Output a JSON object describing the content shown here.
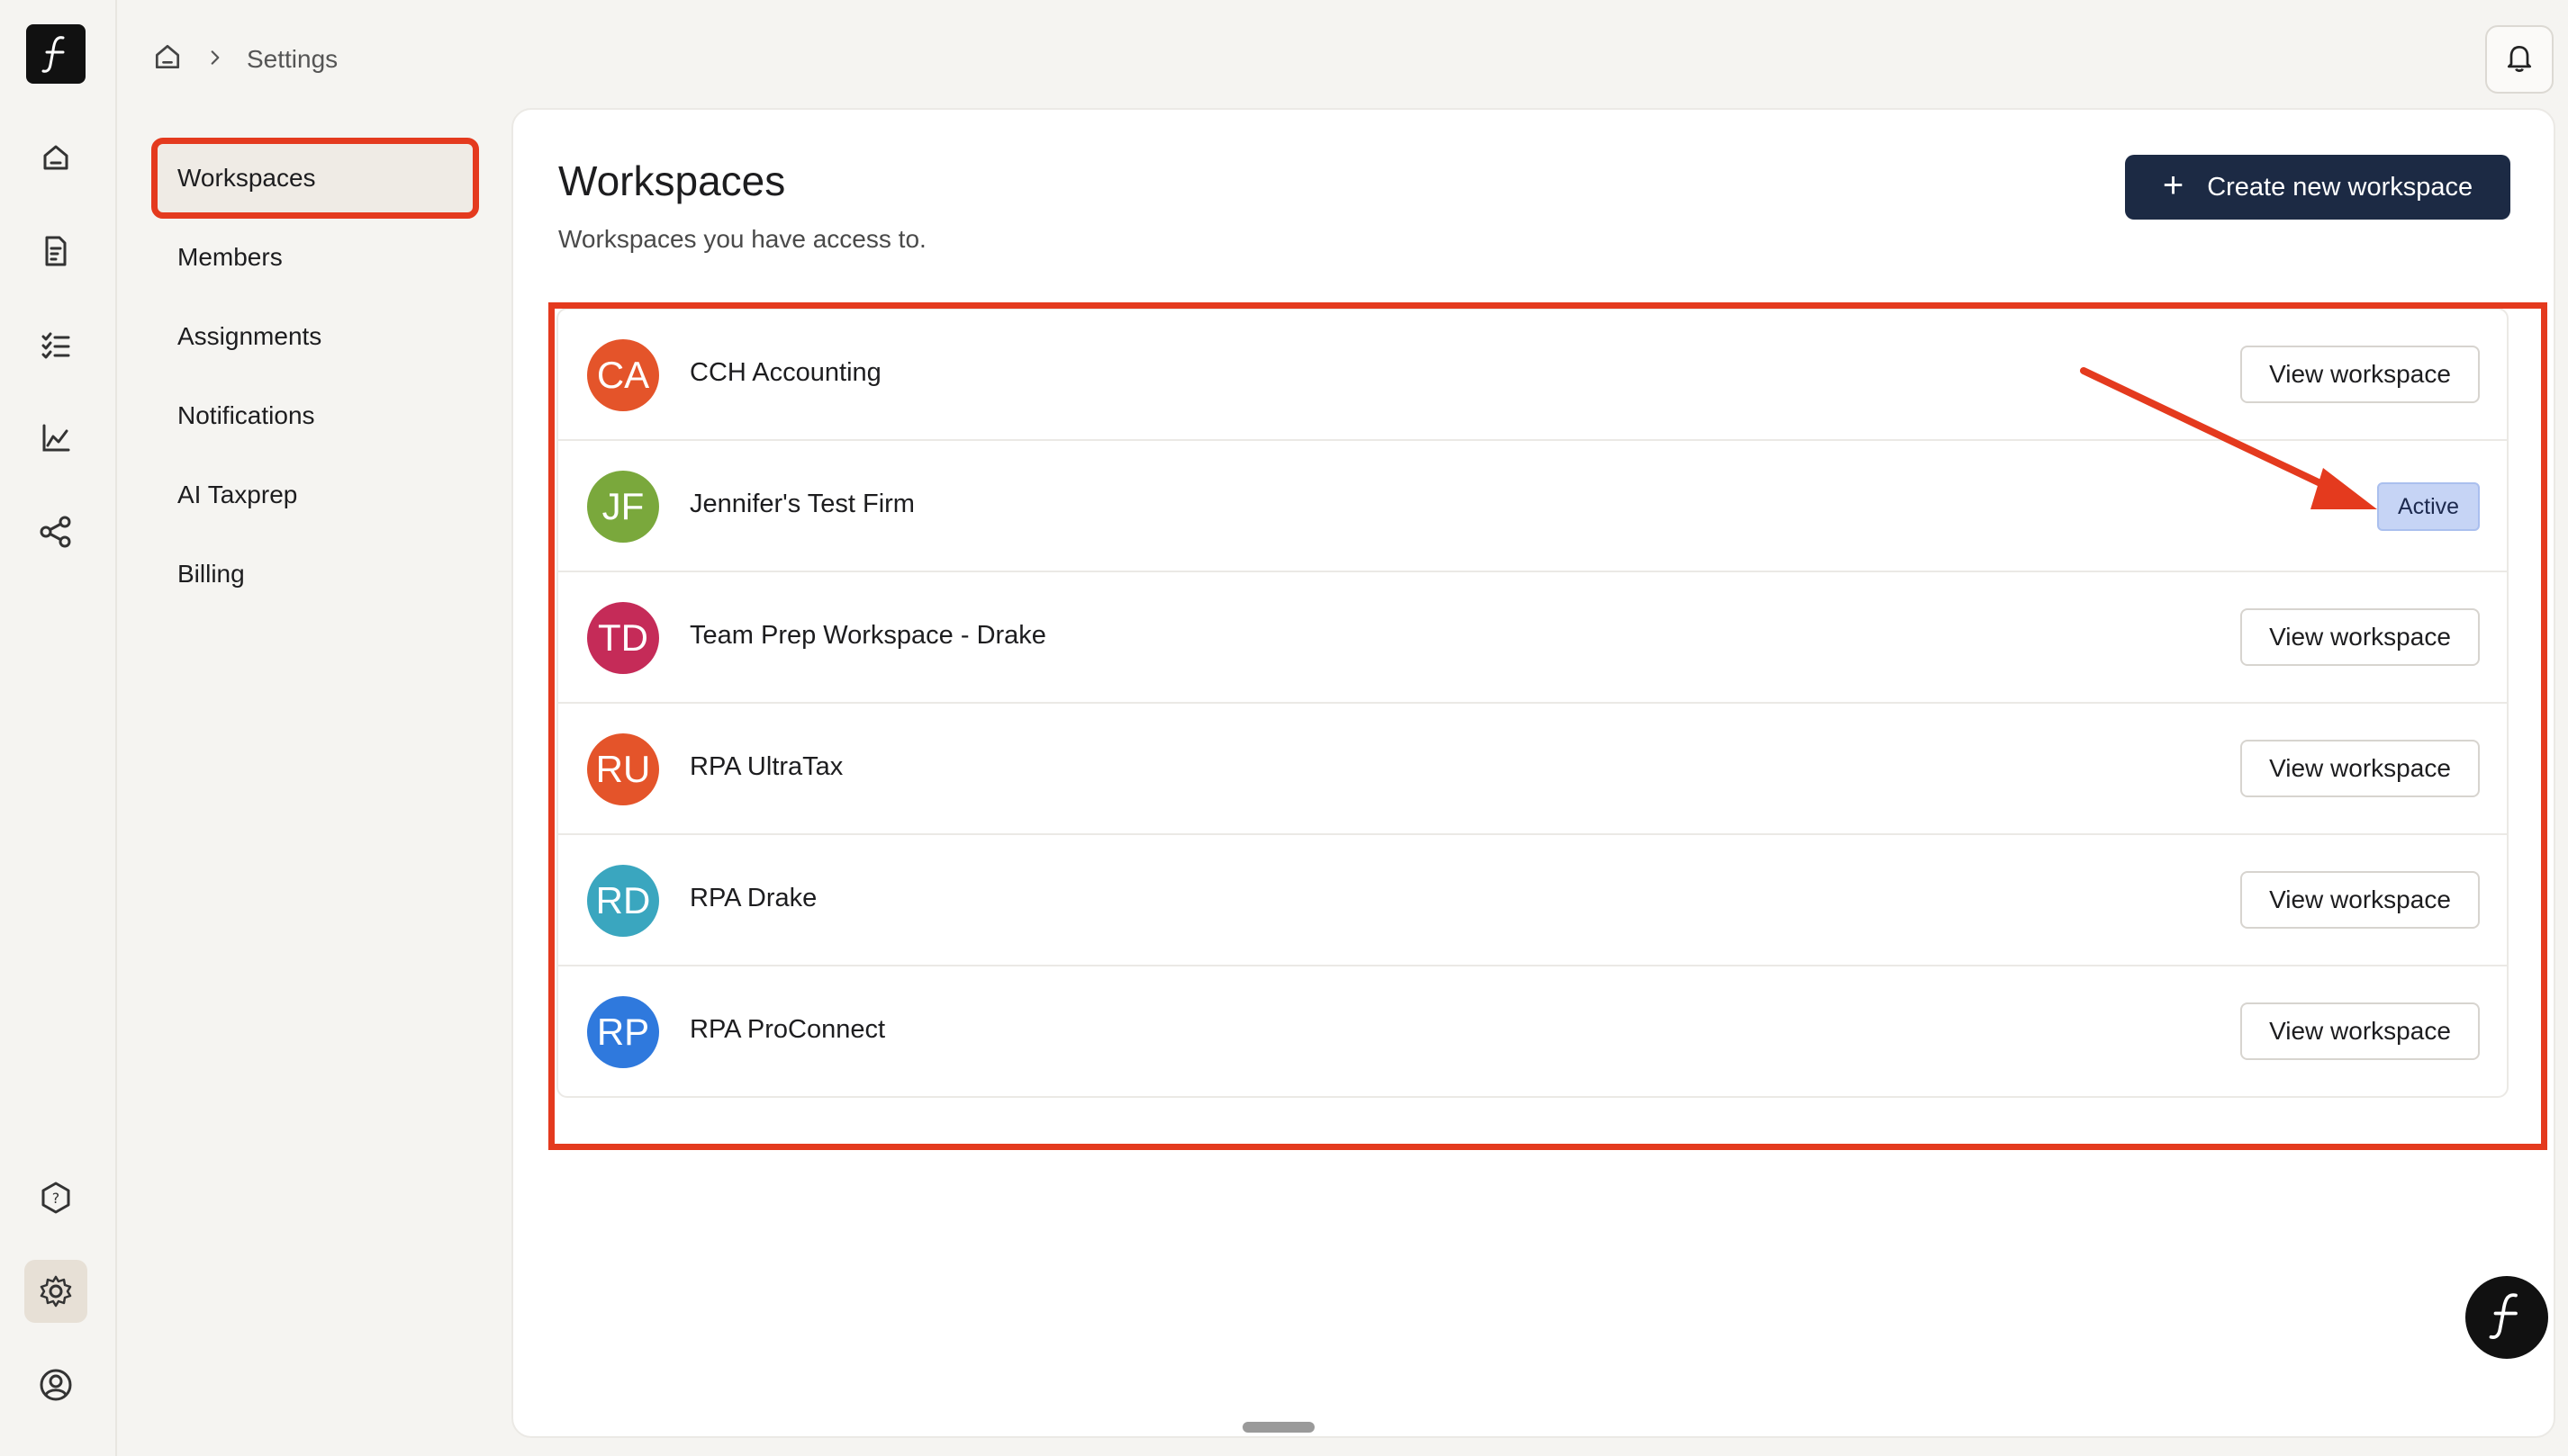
{
  "breadcrumb": {
    "current": "Settings"
  },
  "subnav": {
    "items": [
      {
        "label": "Workspaces"
      },
      {
        "label": "Members"
      },
      {
        "label": "Assignments"
      },
      {
        "label": "Notifications"
      },
      {
        "label": "AI Taxprep"
      },
      {
        "label": "Billing"
      }
    ]
  },
  "main": {
    "title": "Workspaces",
    "subtitle": "Workspaces you have access to.",
    "create_button": "Create new workspace",
    "view_button": "View workspace",
    "active_badge": "Active"
  },
  "workspaces": [
    {
      "initials": "CA",
      "name": "CCH Accounting",
      "color": "#e4542a",
      "active": false
    },
    {
      "initials": "JF",
      "name": "Jennifer's Test Firm",
      "color": "#7aa83c",
      "active": true
    },
    {
      "initials": "TD",
      "name": "Team Prep Workspace - Drake",
      "color": "#c52b58",
      "active": false
    },
    {
      "initials": "RU",
      "name": "RPA UltraTax",
      "color": "#e4542a",
      "active": false
    },
    {
      "initials": "RD",
      "name": "RPA Drake",
      "color": "#3aa6bf",
      "active": false
    },
    {
      "initials": "RP",
      "name": "RPA ProConnect",
      "color": "#2f79dd",
      "active": false
    }
  ],
  "colors": {
    "accent_dark": "#1c2a44",
    "annotation_red": "#e43a1e",
    "badge_blue": "#c6d4f5"
  },
  "icons": [
    "logo-icon",
    "home-icon",
    "document-icon",
    "checklist-icon",
    "chart-icon",
    "share-icon",
    "help-icon",
    "gear-icon",
    "user-circle-icon",
    "bell-icon",
    "chevron-right-icon",
    "plus-icon"
  ]
}
